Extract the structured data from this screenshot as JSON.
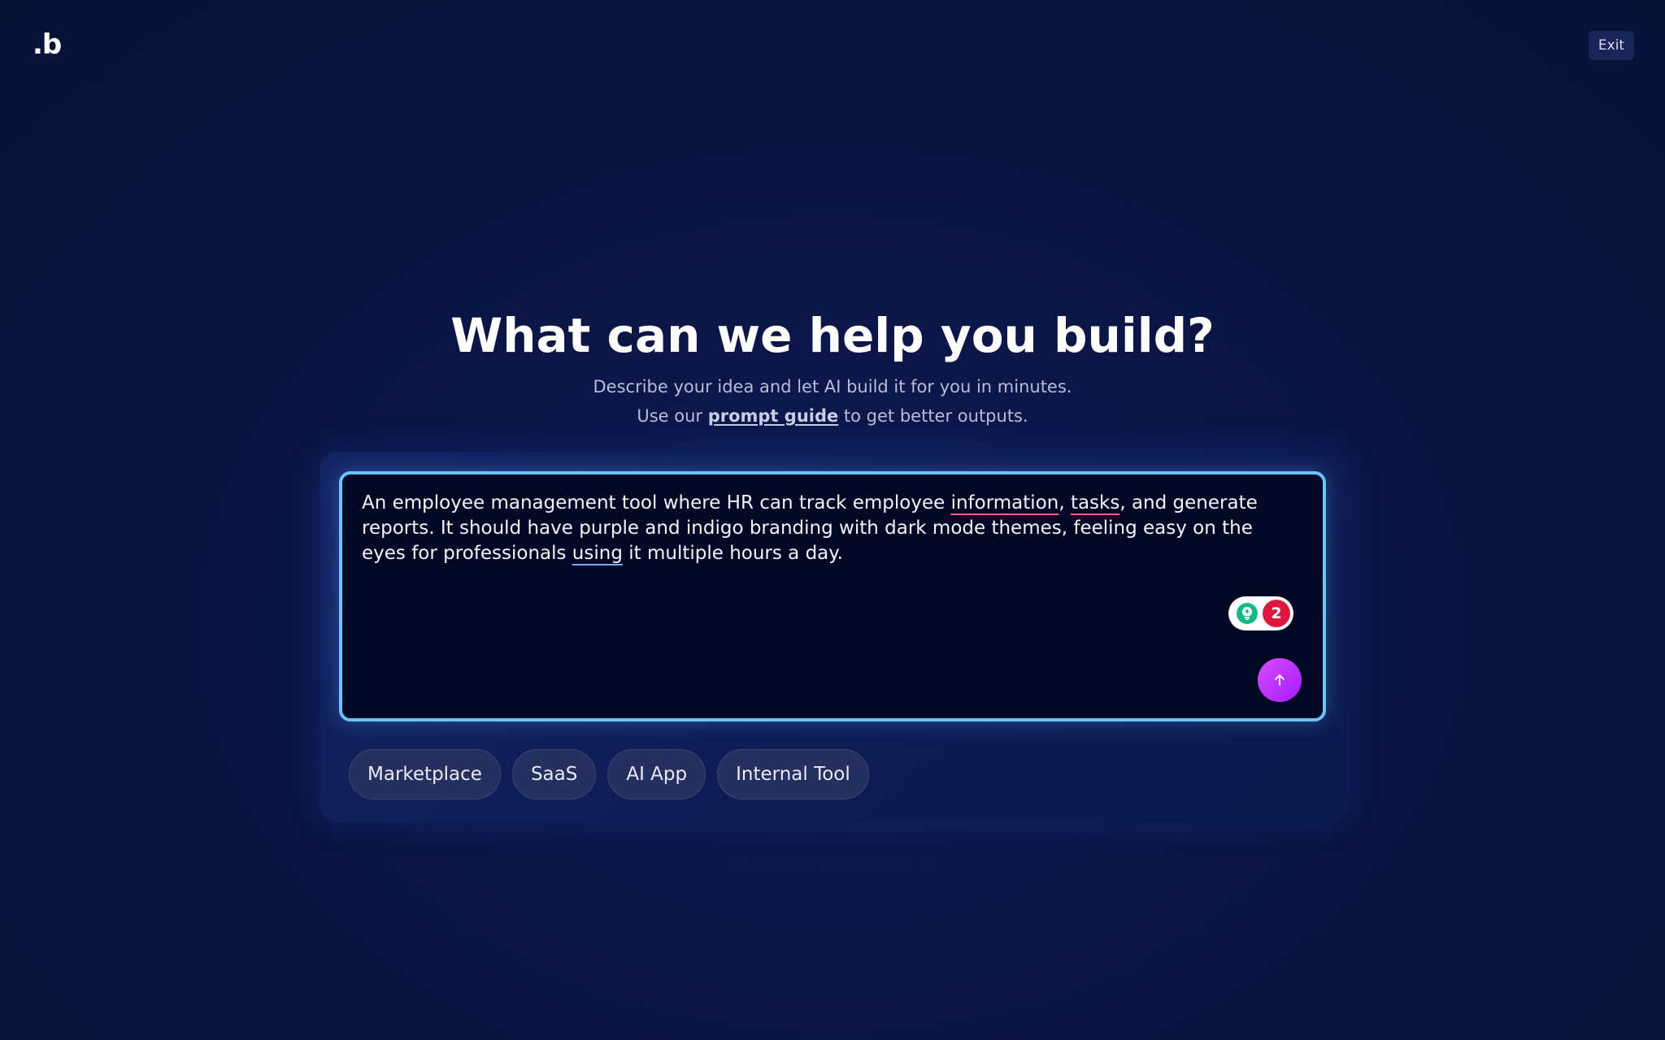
{
  "header": {
    "logo_text": ".b",
    "exit_label": "Exit"
  },
  "hero": {
    "title": "What can we help you build?",
    "subtitle": "Describe your idea and let AI build it for you in minutes.",
    "guide_prefix": "Use our ",
    "guide_link": "prompt guide",
    "guide_suffix": " to get better outputs."
  },
  "prompt": {
    "segments": [
      "An employee management tool where HR can track employee ",
      "information",
      ", ",
      "tasks",
      ", and generate reports. It should have purple and indigo branding with dark mode themes, feeling easy on the eyes for professionals ",
      "using",
      " it multiple hours a day."
    ],
    "issue_count": "2"
  },
  "chips": [
    "Marketplace",
    "SaaS",
    "AI App",
    "Internal Tool"
  ],
  "colors": {
    "background": "#0b1441",
    "accent_border": "#6cc4ff",
    "send_button": "#b32bff",
    "issue_badge": "#e0173c"
  },
  "icons": {
    "send": "arrow-up-icon",
    "grammar": "lightbulb-icon"
  }
}
